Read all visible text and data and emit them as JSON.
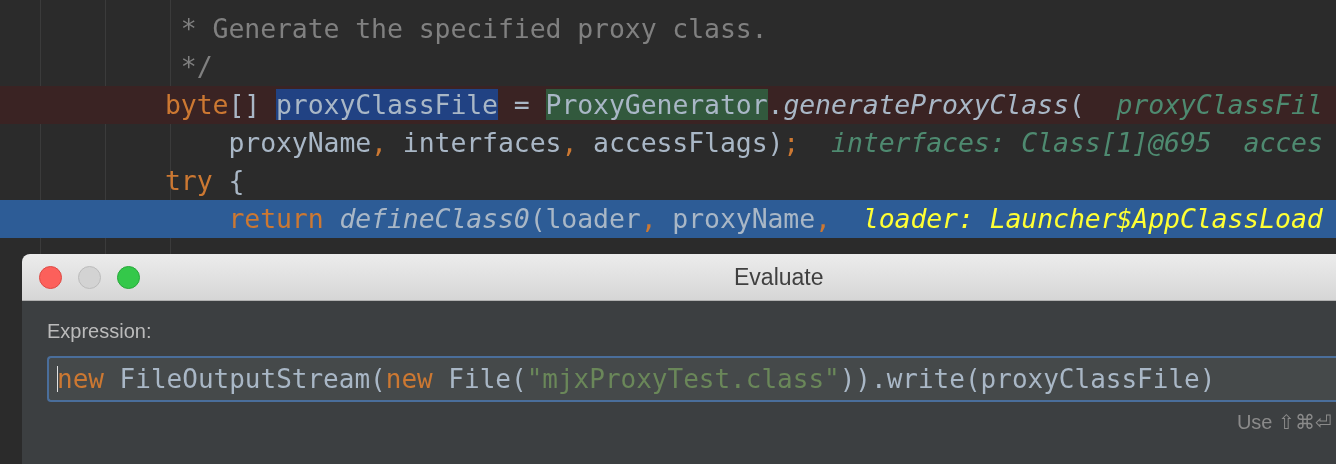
{
  "editor": {
    "lines": [
      {
        "kind": "normal",
        "tokens": [
          {
            "kind": "comment",
            "text": " * Generate the specified proxy class."
          }
        ]
      },
      {
        "kind": "normal",
        "tokens": [
          {
            "kind": "comment",
            "text": " */"
          }
        ]
      },
      {
        "kind": "breakpoint",
        "tokens": [
          {
            "kind": "keyword",
            "text": "byte"
          },
          {
            "kind": "plain",
            "text": "[] "
          },
          {
            "kind": "selected",
            "text": "proxyClassFile"
          },
          {
            "kind": "plain",
            "text": " = "
          },
          {
            "kind": "usage",
            "text": "ProxyGenerator"
          },
          {
            "kind": "plain",
            "text": "."
          },
          {
            "kind": "method",
            "text": "generateProxyClass"
          },
          {
            "kind": "plain",
            "text": "("
          },
          {
            "kind": "hint",
            "text": "proxyClassFil"
          }
        ]
      },
      {
        "kind": "normal",
        "tokens": [
          {
            "kind": "plain",
            "text": "    proxyName"
          },
          {
            "kind": "keyword",
            "text": ","
          },
          {
            "kind": "plain",
            "text": " interfaces"
          },
          {
            "kind": "keyword",
            "text": ","
          },
          {
            "kind": "plain",
            "text": " accessFlags)"
          },
          {
            "kind": "keyword",
            "text": ";"
          },
          {
            "kind": "hint",
            "text": "interfaces: Class[1]@695"
          },
          {
            "kind": "hint",
            "text": "acces"
          }
        ]
      },
      {
        "kind": "normal",
        "tokens": [
          {
            "kind": "keyword",
            "text": "try"
          },
          {
            "kind": "plain",
            "text": " {"
          }
        ]
      },
      {
        "kind": "execution",
        "tokens": [
          {
            "kind": "keyword",
            "text": "    return"
          },
          {
            "kind": "method",
            "text": " defineClass0"
          },
          {
            "kind": "plain",
            "text": "(loader"
          },
          {
            "kind": "keyword",
            "text": ","
          },
          {
            "kind": "plain",
            "text": " proxyName"
          },
          {
            "kind": "keyword",
            "text": ","
          },
          {
            "kind": "hint-current",
            "text": "loader: Launcher$AppClassLoad"
          }
        ]
      }
    ]
  },
  "dialog": {
    "title": "Evaluate",
    "expression_label": "Expression:",
    "expression": [
      {
        "kind": "keyword",
        "text": "new"
      },
      {
        "kind": "plain",
        "text": " FileOutputStream("
      },
      {
        "kind": "keyword",
        "text": "new"
      },
      {
        "kind": "plain",
        "text": " File("
      },
      {
        "kind": "string",
        "text": "\"mjxProxyTest.class\""
      },
      {
        "kind": "plain",
        "text": ")).write(proxyClassFile)"
      }
    ],
    "shortcut_hint": "Use ⇧⌘⏎"
  }
}
